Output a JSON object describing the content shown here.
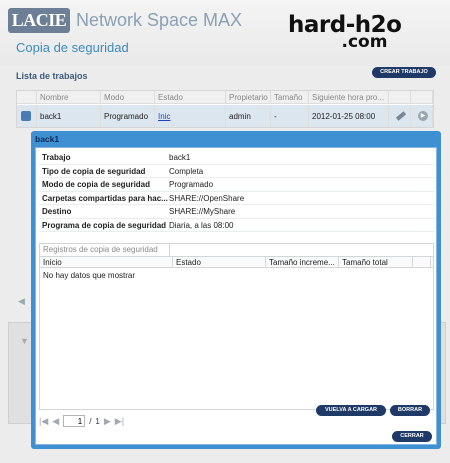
{
  "header": {
    "logo_text": "LACIE",
    "product_name": "Network Space MAX",
    "page_title": "Copia de seguridad"
  },
  "watermark": {
    "line1": "hard-h2o",
    "line2": ".com"
  },
  "jobs": {
    "section_title": "Lista de trabajos",
    "create_button": "CREAR TRABAJO",
    "columns": [
      "Nombre",
      "Modo",
      "Estado",
      "Propietario",
      "Tamaño",
      "Siguiente hora pro..."
    ],
    "rows": [
      {
        "name": "back1",
        "mode": "Programado",
        "status": "Inic",
        "owner": "admin",
        "size": "-",
        "next_time": "2012-01-25 08:00"
      }
    ]
  },
  "modal": {
    "title": "back1",
    "properties": [
      {
        "key": "Trabajo",
        "value": "back1"
      },
      {
        "key": "Tipo de copia de seguridad",
        "value": "Completa"
      },
      {
        "key": "Modo de copia de seguridad",
        "value": "Programado"
      },
      {
        "key": "Carpetas compartidas para hac...",
        "value": "SHARE://OpenShare"
      },
      {
        "key": "Destino",
        "value": "SHARE://MyShare"
      },
      {
        "key": "Programa de copia de seguridad",
        "value": "Diaria, a las 08:00"
      }
    ],
    "logs": {
      "tab_label": "Registros de copia de seguridad",
      "columns": [
        "Inicio",
        "Estado",
        "Tamaño increme...",
        "Tamaño total"
      ],
      "empty_text": "No hay datos que mostrar"
    },
    "pager": {
      "page": "1",
      "separator": "/",
      "total": "1"
    },
    "reload_button": "VUELVA A CARGAR",
    "delete_button": "BORRAR",
    "close_button": "CERRAR"
  },
  "colors": {
    "accent_blue": "#3e90d2",
    "navy_button": "#1f3a66",
    "title_blue": "#3d8bbd"
  }
}
